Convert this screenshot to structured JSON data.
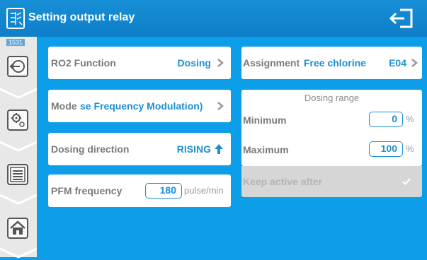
{
  "header": {
    "title": "Setting output relay",
    "page_id": "1531"
  },
  "left": {
    "ro2_function": {
      "label": "RO2 Function",
      "value": "Dosing"
    },
    "mode": {
      "label": "Mode",
      "value": "se Frequency Modulation)"
    },
    "dosing_direction": {
      "label": "Dosing direction",
      "value": "RISING"
    },
    "pfm_frequency": {
      "label": "PFM frequency",
      "value": "180",
      "unit": "pulse/min"
    }
  },
  "right": {
    "assignment": {
      "label": "Assignment",
      "value": "Free chlorine",
      "code": "E04"
    },
    "dosing_range": {
      "title": "Dosing range",
      "minimum": {
        "label": "Minimum",
        "value": "0",
        "unit": "%"
      },
      "maximum": {
        "label": "Maximum",
        "value": "100",
        "unit": "%"
      }
    },
    "keep_active": {
      "label": "Keep active after",
      "checked": true
    }
  },
  "colors": {
    "accent": "#1b8fd6",
    "background": "#0c9ee8",
    "header": "#1286cf",
    "disabled": "#d6d6d6"
  },
  "icons": {
    "header_left": "relay-settings-icon",
    "header_right": "exit-icon",
    "sidebar": [
      "back-icon",
      "settings-icon",
      "menu-icon",
      "home-icon"
    ]
  }
}
